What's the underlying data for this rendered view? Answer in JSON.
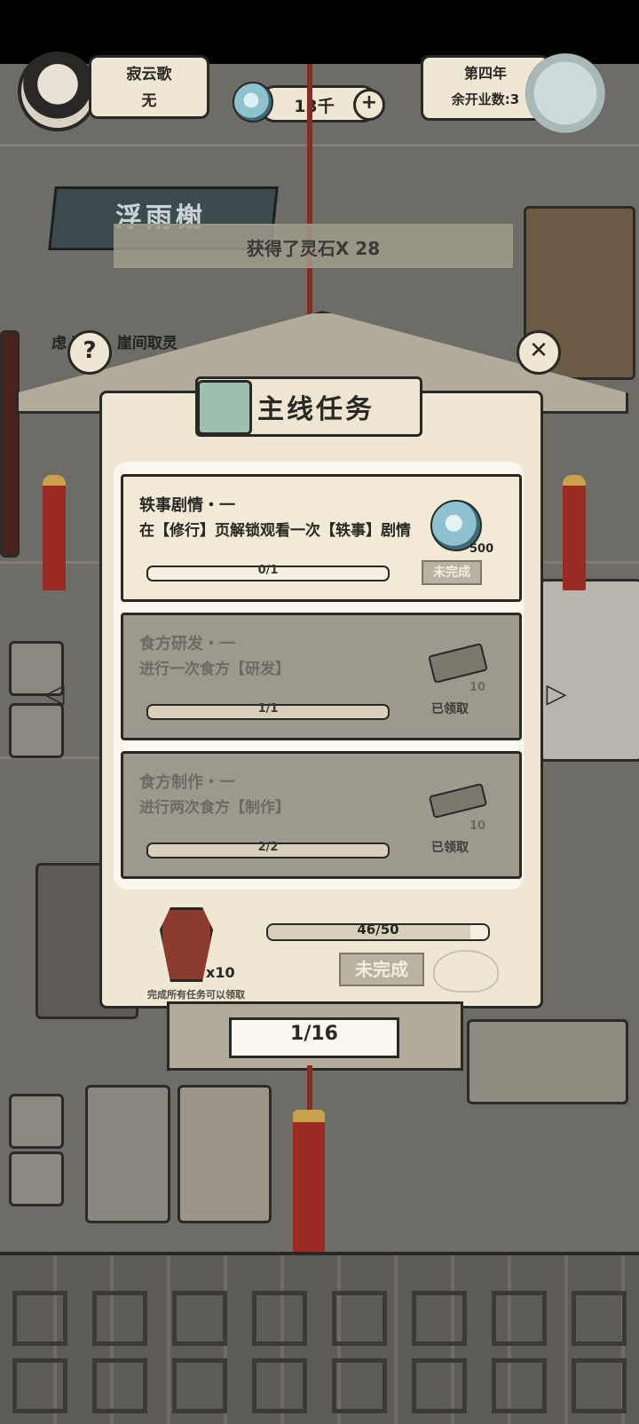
{
  "hud": {
    "player_name": "寂云歌",
    "player_title": "无",
    "spirit_stones": "13千",
    "year": "第四年",
    "remaining_open": "余开业数:3"
  },
  "shop_sign": "浮雨榭",
  "toast": "获得了灵石X 28",
  "hint_line": "虑   草性，崖间取灵   ",
  "panel": {
    "title": "主线任务",
    "tasks": [
      {
        "title": "轶事剧情・一",
        "desc": "在【修行】页解锁观看一次【轶事】剧情",
        "progress_text": "0/1",
        "progress": 0,
        "reward_icon": "spirit-stone-icon",
        "reward_amount": "500",
        "status": "未完成"
      },
      {
        "title": "食方研发・一",
        "desc": "进行一次食方【研发】",
        "progress_text": "1/1",
        "progress": 1,
        "reward_icon": "tool-icon",
        "reward_amount": "10",
        "status": "已领取"
      },
      {
        "title": "食方制作・一",
        "desc": "进行两次食方【制作】",
        "progress_text": "2/2",
        "progress": 1,
        "reward_icon": "tool-icon",
        "reward_amount": "10",
        "status": "已领取"
      }
    ],
    "final_reward_count": "x10",
    "final_hint": "完成所有任务可以领取",
    "overall_progress_text": "46/50",
    "overall_progress": 0.92,
    "final_status": "未完成"
  },
  "pagination": "1/16",
  "colors": {
    "ink": "#2a2824",
    "parchment": "#efe7d4",
    "accent_red": "#9b2a22",
    "done_card": "#9d998e"
  }
}
